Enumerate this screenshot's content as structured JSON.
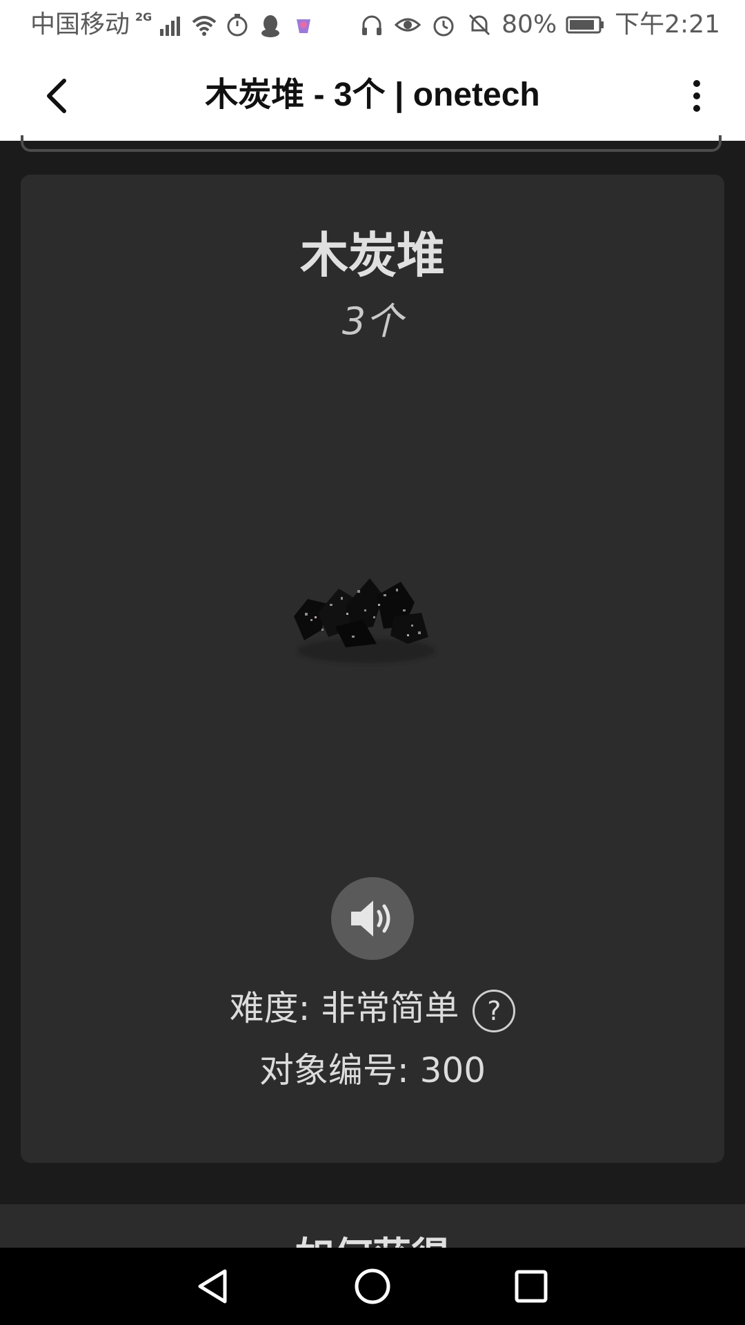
{
  "status_bar": {
    "carrier": "中国移动",
    "network": "2G",
    "battery": "80%",
    "time": "下午2:21"
  },
  "app_bar": {
    "title": "木炭堆 - 3个 | onetech"
  },
  "object": {
    "name": "木炭堆",
    "count": "3个",
    "difficulty": "难度: 非常简单",
    "help_symbol": "?",
    "object_id": "对象编号: 300"
  },
  "next_section": {
    "heading": "如何获得"
  },
  "colors": {
    "background": "#1b1b1b",
    "card": "#2c2c2c",
    "text": "#e0e0e0",
    "sound_button": "#5a5a5a"
  }
}
